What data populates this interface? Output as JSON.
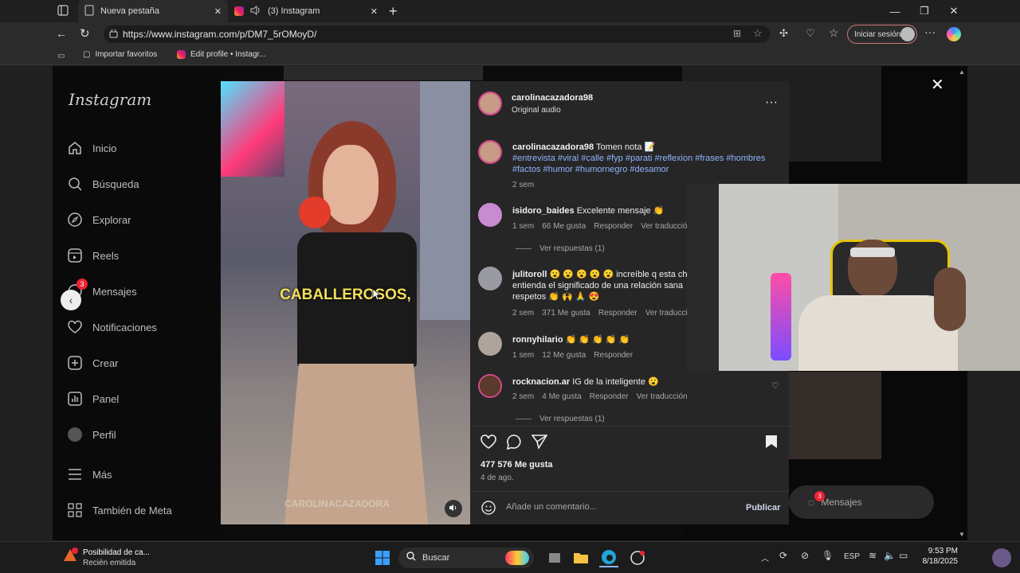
{
  "browser": {
    "tabs": [
      {
        "label": "Nueva pestaña"
      },
      {
        "label": "(3) Instagram"
      }
    ],
    "url": "https://www.instagram.com/p/DM7_5rOMoyD/",
    "signin_label": "Iniciar sesión",
    "bookmarks": [
      {
        "label": "Importar favoritos"
      },
      {
        "label": "Edit profile • Instagr..."
      }
    ]
  },
  "sidebar": {
    "logo": "Instagram",
    "items": [
      {
        "label": "Inicio",
        "icon": "home-icon"
      },
      {
        "label": "Búsqueda",
        "icon": "search-icon"
      },
      {
        "label": "Explorar",
        "icon": "compass-icon"
      },
      {
        "label": "Reels",
        "icon": "reels-icon"
      },
      {
        "label": "Mensajes",
        "icon": "messenger-icon",
        "badge": "3"
      },
      {
        "label": "Notificaciones",
        "icon": "heart-icon"
      },
      {
        "label": "Crear",
        "icon": "plus-square-icon"
      },
      {
        "label": "Panel",
        "icon": "dashboard-icon"
      },
      {
        "label": "Perfil",
        "icon": "avatar-icon"
      },
      {
        "label": "Más",
        "icon": "menu-icon"
      },
      {
        "label": "También de Meta",
        "icon": "meta-grid-icon"
      }
    ]
  },
  "video": {
    "caption": "CABALLEROSOS,",
    "watermark": "CAROLINACAZADORA"
  },
  "post": {
    "author": "carolinacazadora98",
    "audio": "Original audio",
    "caption_text": "Tomen nota 📝",
    "hashtags": "#entrevista #viral #calle #fyp #parati #reflexion #frases #hombres #factos #humor #humornegro #desamor",
    "caption_time": "2 sem",
    "likes": "477 576 Me gusta",
    "date": "4 de ago.",
    "comment_placeholder": "Añade un comentario...",
    "publish_label": "Publicar"
  },
  "comments": [
    {
      "user": "isidoro_baides",
      "text": "Excelente mensaje 👏",
      "time": "1 sem",
      "likes": "66 Me gusta",
      "reply": "Responder",
      "translate": "Ver traducción",
      "view_replies": "Ver respuestas (1)"
    },
    {
      "user": "julitoroll",
      "text": "😮 😮 😮 😮 😮 increíble q esta chi",
      "text2": "entienda el significado de una relación sana",
      "text3": "respetos 👏 🙌 🙏 😍",
      "time": "2 sem",
      "likes": "371 Me gusta",
      "reply": "Responder",
      "translate": "Ver traducción"
    },
    {
      "user": "ronnyhilario",
      "text": "👏 👏 👏 👏 👏",
      "time": "1 sem",
      "likes": "12 Me gusta",
      "reply": "Responder"
    },
    {
      "user": "rocknacion.ar",
      "text": "IG de la inteligente 😮",
      "time": "2 sem",
      "likes": "4 Me gusta",
      "reply": "Responder",
      "translate": "Ver traducción",
      "view_replies": "Ver respuestas (1)"
    }
  ],
  "floating_messages": {
    "label": "Mensajes",
    "badge": "3"
  },
  "taskbar": {
    "notification_title": "Posibilidad de ca...",
    "notification_sub": "Recién emitida",
    "search_label": "Buscar",
    "lang": "ESP",
    "time": "9:53 PM",
    "date": "8/18/2025"
  }
}
